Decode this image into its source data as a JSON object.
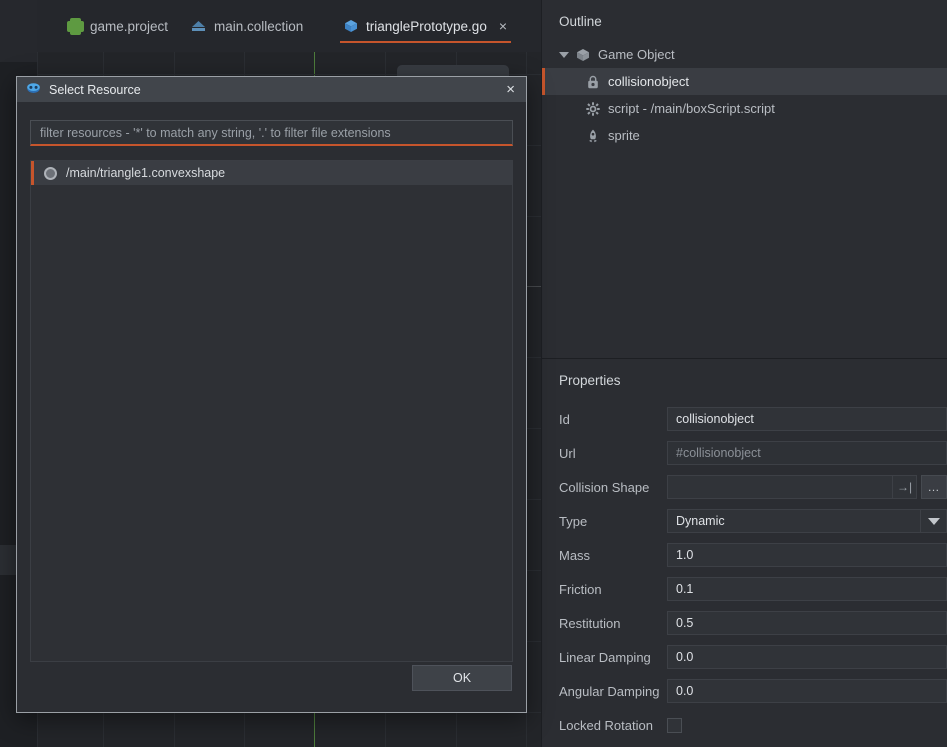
{
  "app": {
    "accent_orange": "#c6552c",
    "panel_bg": "#2b2d32",
    "scene_bg": "#232529"
  },
  "tabs": [
    {
      "label": "game.project",
      "icon": "project-icon",
      "active": false,
      "closable": false
    },
    {
      "label": "main.collection",
      "icon": "collection-icon",
      "active": false,
      "closable": false
    },
    {
      "label": "trianglePrototype.go",
      "icon": "game-object-icon",
      "active": true,
      "closable": true,
      "close_label": "×"
    }
  ],
  "outline": {
    "title": "Outline",
    "items": [
      {
        "label": "Game Object",
        "icon": "game-object-icon",
        "depth": 0,
        "expanded": true,
        "selected": false
      },
      {
        "label": "collisionobject",
        "icon": "collision-object-icon",
        "depth": 1,
        "expanded": false,
        "selected": true
      },
      {
        "label": "script - /main/boxScript.script",
        "icon": "script-icon",
        "depth": 1,
        "expanded": false,
        "selected": false
      },
      {
        "label": "sprite",
        "icon": "sprite-icon",
        "depth": 1,
        "expanded": false,
        "selected": false
      }
    ]
  },
  "properties": {
    "title": "Properties",
    "rows": [
      {
        "label": "Id",
        "value": "collisionobject",
        "kind": "text"
      },
      {
        "label": "Url",
        "value": "#collisionobject",
        "kind": "readonly"
      },
      {
        "label": "Collision Shape",
        "value": "",
        "kind": "resource",
        "goto_glyph": "→|",
        "dots_label": "…"
      },
      {
        "label": "Type",
        "value": "Dynamic",
        "kind": "combo"
      },
      {
        "label": "Mass",
        "value": "1.0",
        "kind": "text"
      },
      {
        "label": "Friction",
        "value": "0.1",
        "kind": "text"
      },
      {
        "label": "Restitution",
        "value": "0.5",
        "kind": "text"
      },
      {
        "label": "Linear Damping",
        "value": "0.0",
        "kind": "text"
      },
      {
        "label": "Angular Damping",
        "value": "0.0",
        "kind": "text"
      },
      {
        "label": "Locked Rotation",
        "value": "",
        "kind": "checkbox",
        "checked": false
      }
    ]
  },
  "dialog": {
    "title": "Select Resource",
    "icon": "defold-logo-icon",
    "close_label": "×",
    "filter_placeholder": "filter resources - '*' to match any string, '.' to filter file extensions",
    "filter_value": "",
    "results": [
      {
        "label": "/main/triangle1.convexshape",
        "icon": "convexshape-icon",
        "selected": true
      }
    ],
    "ok_label": "OK"
  }
}
